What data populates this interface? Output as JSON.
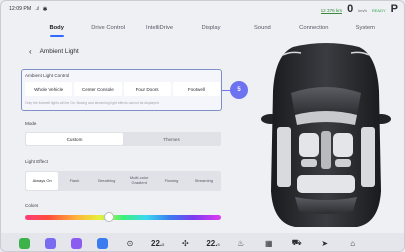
{
  "status_bar": {
    "time": "12:09 PM",
    "signal": "..ıl",
    "battery_range": "12 376 km",
    "speed": "0",
    "speed_unit": "km/h",
    "ready": "READY",
    "gear": "P"
  },
  "tabs": [
    {
      "label": "Body",
      "active": true
    },
    {
      "label": "Drive Control",
      "active": false
    },
    {
      "label": "IntelliDrive",
      "active": false
    },
    {
      "label": "Display",
      "active": false
    },
    {
      "label": "Sound",
      "active": false
    },
    {
      "label": "Connection",
      "active": false
    },
    {
      "label": "System",
      "active": false
    }
  ],
  "page": {
    "title": "Ambient Light"
  },
  "ambient_control": {
    "title": "Ambient Light Control",
    "options": [
      "Whole Vehicle",
      "Center Console",
      "Four Doors",
      "Footwell"
    ],
    "note": "Only the footwell lights will be On, flowing and streaming light effects cannot be displayed",
    "step_badge": "5"
  },
  "mode": {
    "label": "Mode",
    "options": [
      "Custom",
      "Themes"
    ],
    "selected": "Custom"
  },
  "light_effect": {
    "label": "Light Effect",
    "options": [
      "Always On",
      "Flash",
      "Breathing",
      "Multi-color Gradient",
      "Flowing",
      "Streaming"
    ],
    "selected": "Always On"
  },
  "colors": {
    "label": "Colors",
    "slider_position": 0.43
  },
  "dock": {
    "apps": [
      {
        "icon": "phone-app-icon",
        "color": "#3cb24a"
      },
      {
        "icon": "media-app-icon",
        "color": "#7a6cf0"
      },
      {
        "icon": "video-app-icon",
        "color": "#8a5cf0"
      },
      {
        "icon": "music-app-icon",
        "color": "#3a7bf0"
      }
    ],
    "left_temp": "22.",
    "left_temp_decimal": "5",
    "right_temp": "22.",
    "right_temp_decimal": "5"
  },
  "colors_theme": {
    "accent": "#2f6bff",
    "badge": "#6d72f0",
    "panel_border": "#7f90c9"
  }
}
